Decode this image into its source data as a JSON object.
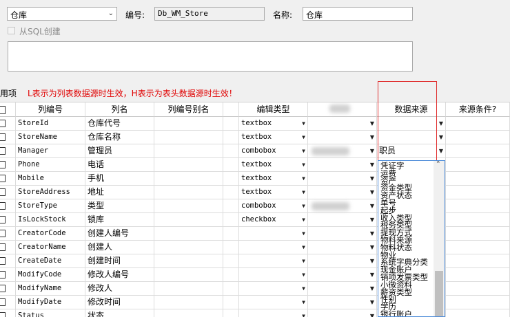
{
  "form": {
    "category_select": "仓库",
    "code_label": "编号:",
    "code_value": "Db_WM_Store",
    "name_label": "名称:",
    "name_value": "仓库",
    "from_sql_label": "从SQL创建",
    "memo": ""
  },
  "hint": {
    "used_items_label": "用项",
    "text": "L表示为列表数据源时生效，H表示为表头数据源时生效！"
  },
  "grid": {
    "headers": [
      "",
      "列编号",
      "列名",
      "列编号别名",
      "",
      "编辑类型",
      "",
      "",
      "数据来源",
      "来源条件?"
    ],
    "rows": [
      {
        "code": "StoreId",
        "name": "仓库代号",
        "type": "textbox",
        "source": ""
      },
      {
        "code": "StoreName",
        "name": "仓库名称",
        "type": "textbox",
        "source": ""
      },
      {
        "code": "Manager",
        "name": "管理员",
        "type": "combobox",
        "source": "职员"
      },
      {
        "code": "Phone",
        "name": "电话",
        "type": "textbox",
        "source": ""
      },
      {
        "code": "Mobile",
        "name": "手机",
        "type": "textbox",
        "source": ""
      },
      {
        "code": "StoreAddress",
        "name": "地址",
        "type": "textbox",
        "source": ""
      },
      {
        "code": "StoreType",
        "name": "类型",
        "type": "combobox",
        "source": ""
      },
      {
        "code": "IsLockStock",
        "name": "锁库",
        "type": "checkbox",
        "source": ""
      },
      {
        "code": "CreatorCode",
        "name": "创建人编号",
        "type": "",
        "source": ""
      },
      {
        "code": "CreatorName",
        "name": "创建人",
        "type": "",
        "source": ""
      },
      {
        "code": "CreateDate",
        "name": "创建时间",
        "type": "",
        "source": ""
      },
      {
        "code": "ModifyCode",
        "name": "修改人编号",
        "type": "",
        "source": ""
      },
      {
        "code": "ModifyName",
        "name": "修改人",
        "type": "",
        "source": ""
      },
      {
        "code": "ModifyDate",
        "name": "修改时间",
        "type": "",
        "source": ""
      },
      {
        "code": "Status",
        "name": "状态",
        "type": "",
        "source": ""
      }
    ]
  },
  "source_list": {
    "items": [
      "凭证字",
      "运费",
      "资产",
      "资金类型",
      "资产状态",
      "单号",
      "起步",
      "收入类型",
      "税务类型",
      "提现方式",
      "物料来源",
      "物料状态",
      "物业",
      "系统字典分类",
      "现金账户",
      "销项发票类型",
      "小微资料",
      "薪资类型",
      "性别",
      "学历",
      "银行账户"
    ]
  },
  "icons": {
    "dropdown": "chevron-down-icon",
    "scroll_up": "scroll-up-icon"
  }
}
